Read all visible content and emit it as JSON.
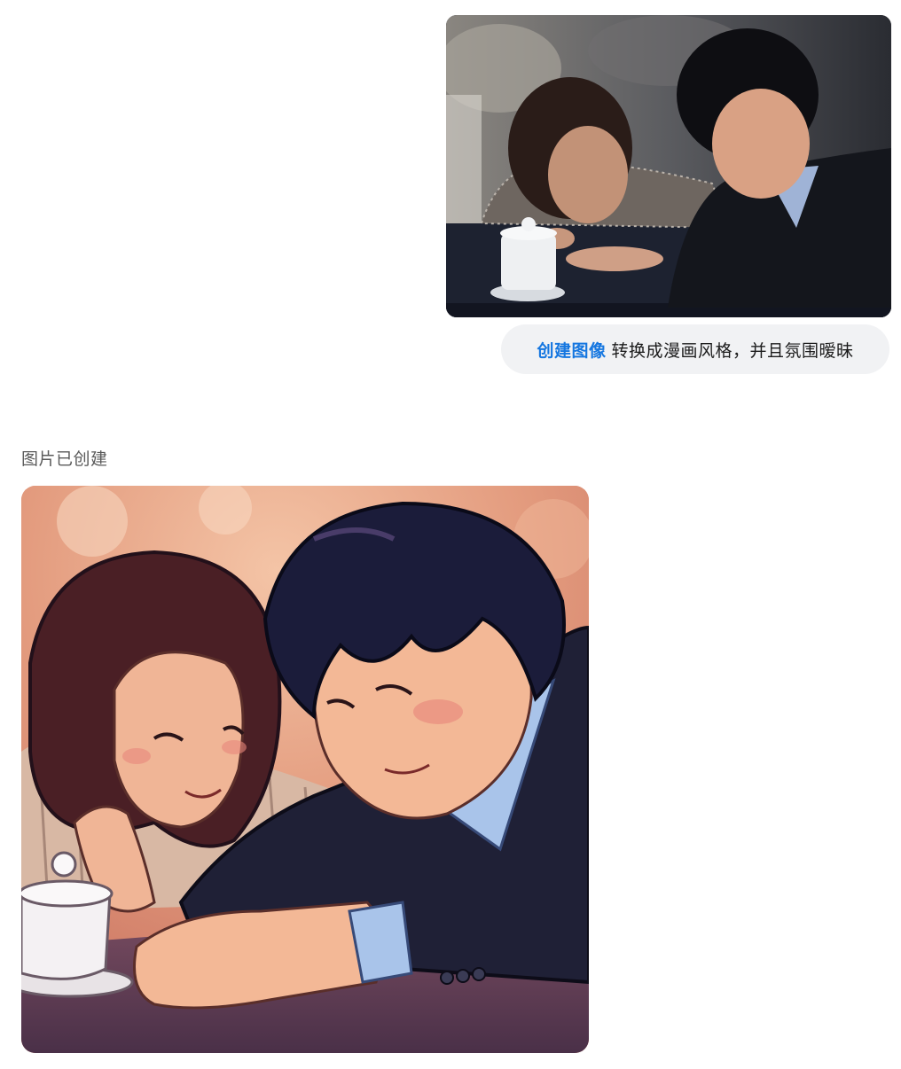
{
  "conversation": {
    "user_message": {
      "photo": {
        "kind": "photo",
        "subject": "two people leaning over a table with a white lidded tea cup"
      },
      "prompt": {
        "tag": "创建图像",
        "text": "转换成漫画风格，并且氛围暧昧"
      }
    },
    "assistant_message": {
      "status": "图片已创建",
      "image": {
        "kind": "illustration",
        "subject": "comic-style two people leaning over a table, tea cup in front"
      }
    }
  },
  "colors": {
    "accent": "#1677e0",
    "bubble_bg": "#f1f2f4",
    "status_text": "#5a5a5a"
  }
}
